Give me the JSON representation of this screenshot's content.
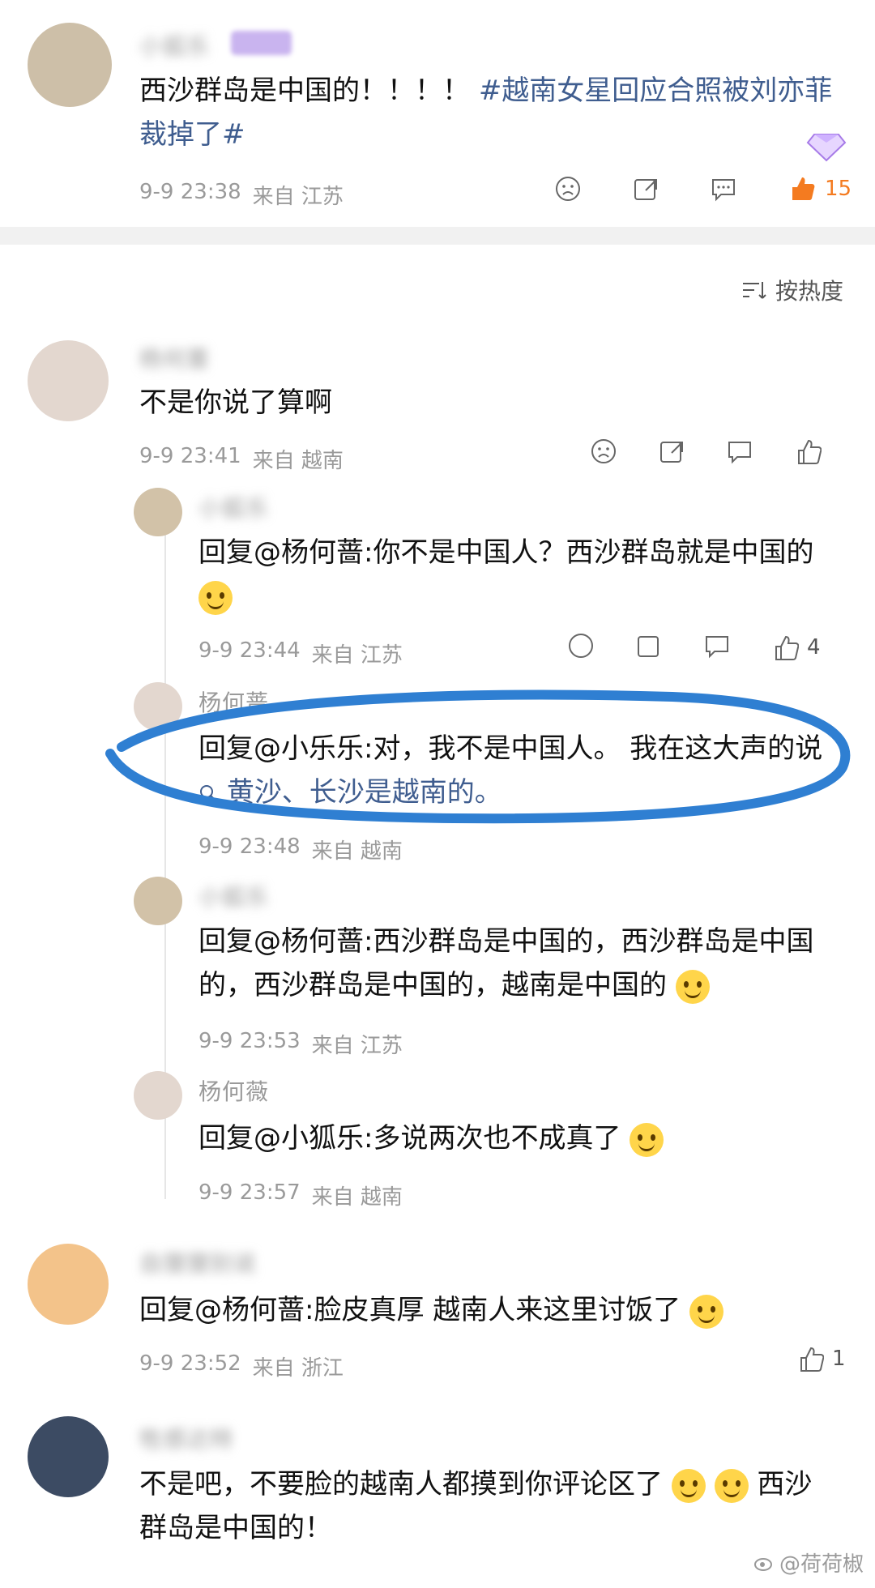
{
  "post": {
    "author": "小狐乐",
    "text": "西沙群岛是中国的！！！！",
    "topic": "#越南女星回应合照被刘亦菲裁掉了#",
    "time": "9-9 23:38",
    "source": "来自 江苏",
    "likes": "15"
  },
  "sort_label": "按热度",
  "comments": [
    {
      "id": "c1",
      "author": "杨何蔷",
      "text": "不是你说了算啊",
      "time": "9-9 23:41",
      "source": "来自 越南",
      "likes": ""
    },
    {
      "id": "r1",
      "author": "小狐乐",
      "text": "回复@杨何蔷:你不是中国人？西沙群岛就是中国的",
      "time": "9-9 23:44",
      "source": "来自 江苏",
      "likes": "4"
    },
    {
      "id": "r2",
      "author": "杨何蔷",
      "text": "回复@小乐乐:对，我不是中国人。 我在这大声的说",
      "search_text": "黄沙、长沙是越南的。",
      "time": "9-9 23:48",
      "source": "来自 越南",
      "likes": ""
    },
    {
      "id": "r3",
      "author": "小狐乐",
      "text": "回复@杨何蔷:西沙群岛是中国的，西沙群岛是中国的，西沙群岛是中国的，越南是中国的",
      "time": "9-9 23:53",
      "source": "来自 江苏",
      "likes": ""
    },
    {
      "id": "r4",
      "author": "杨何薇",
      "text": "回复@小狐乐:多说两次也不成真了",
      "time": "9-9 23:57",
      "source": "来自 越南",
      "likes": ""
    },
    {
      "id": "c2",
      "author": "自狸狸别说",
      "text": "回复@杨何蔷:脸皮真厚 越南人来这里讨饭了",
      "time": "9-9 23:52",
      "source": "来自 浙江",
      "likes": "1"
    },
    {
      "id": "c3",
      "author": "牲感达特",
      "text": "不是吧，不要脸的越南人都摸到你评论区了",
      "text2": "西沙",
      "text3": "群岛是中国的！",
      "time": "",
      "source": "",
      "likes": ""
    }
  ],
  "watermark": "@荷荷椒",
  "colors": {
    "topic": "#3f5d8f",
    "like_orange": "#f47b20",
    "highlight_ring": "#2f7fd2"
  }
}
